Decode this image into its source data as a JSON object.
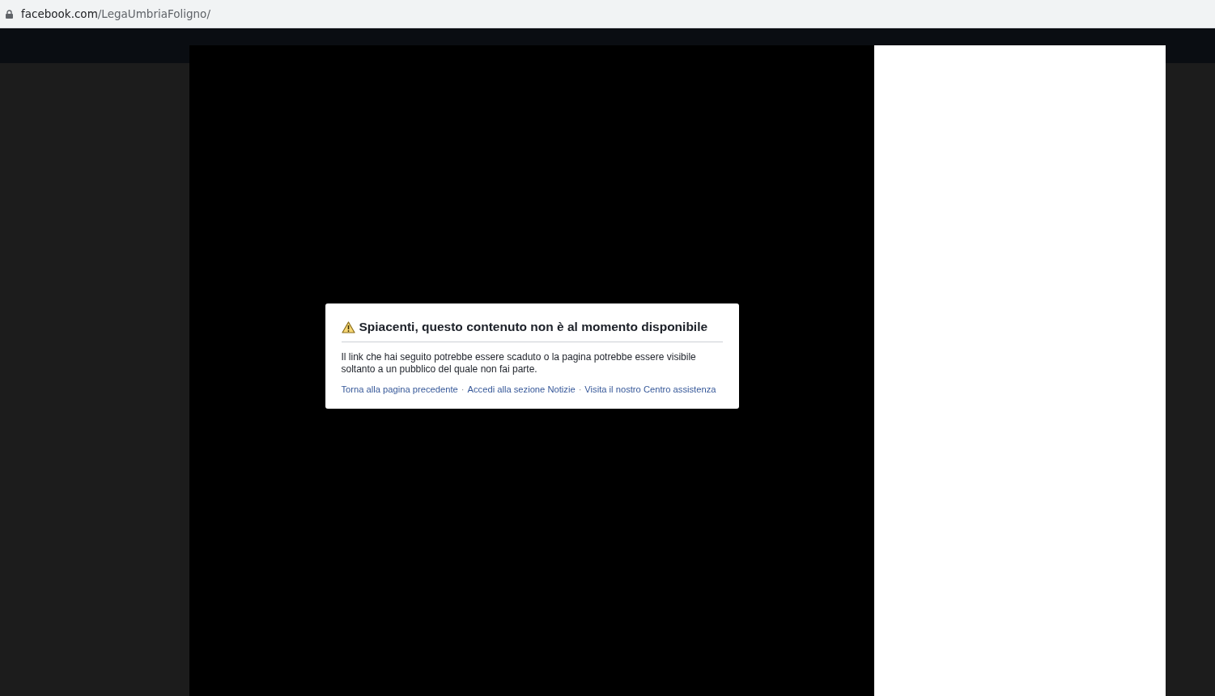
{
  "address_bar": {
    "domain": "facebook.com",
    "path": "/LegaUmbriaFoligno/"
  },
  "dialog": {
    "title": "Spiacenti, questo contenuto non è al momento disponibile",
    "message": "Il link che hai seguito potrebbe essere scaduto o la pagina potrebbe essere visibile soltanto a un pubblico del quale non fai parte.",
    "links": [
      "Torna alla pagina precedente",
      "Accedi alla sezione Notizie",
      "Visita il nostro Centro assistenza"
    ],
    "separator": "·"
  }
}
